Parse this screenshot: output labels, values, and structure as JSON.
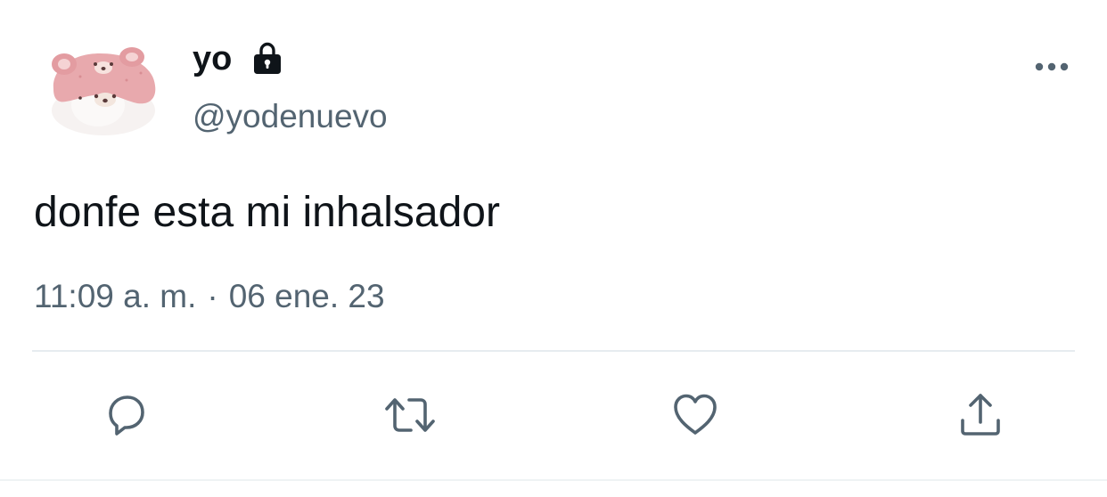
{
  "tweet": {
    "author": {
      "display_name": "yo",
      "handle": "@yodenuevo",
      "protected_icon": "lock-icon",
      "avatar_icon": "bear-plush-avatar"
    },
    "text": "donfe esta mi inhalsador",
    "time": "11:09 a. m.",
    "separator": "·",
    "date": "06 ene. 23"
  },
  "actions": {
    "more_icon": "more-horizontal-icon",
    "reply_icon": "reply-icon",
    "retweet_icon": "retweet-icon",
    "like_icon": "heart-icon",
    "share_icon": "share-icon"
  },
  "colors": {
    "text_primary": "#0f1419",
    "text_secondary": "#536471",
    "icon": "#536471",
    "divider": "#e6ecf0"
  }
}
